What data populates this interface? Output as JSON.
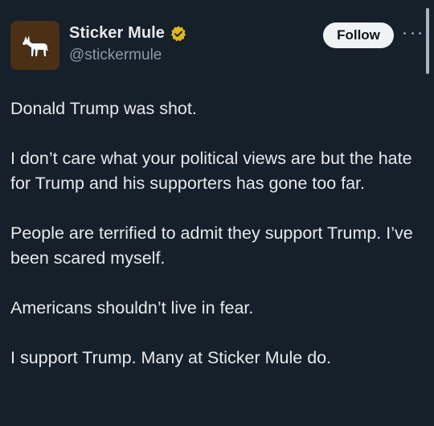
{
  "tweet": {
    "author": {
      "display_name": "Sticker Mule",
      "handle": "@stickermule",
      "avatar_icon": "mule-icon",
      "avatar_bg": "#4b3016",
      "verified_icon": "verified-badge-icon",
      "verified_color": "#e2b719"
    },
    "follow_label": "Follow",
    "more_icon": "more-options-icon",
    "paragraphs": [
      "Donald Trump was shot.",
      "I don’t care what your political views are but the hate for Trump and his supporters has gone too far.",
      "People are terrified to admit they support Trump. I’ve been scared myself.",
      "Americans shouldn’t live in fear.",
      "I support Trump. Many at Sticker Mule do."
    ]
  },
  "colors": {
    "background": "#15202b",
    "text_primary": "#e7e9ea",
    "text_secondary": "#8b98a5",
    "button_bg": "#eff3f4"
  }
}
